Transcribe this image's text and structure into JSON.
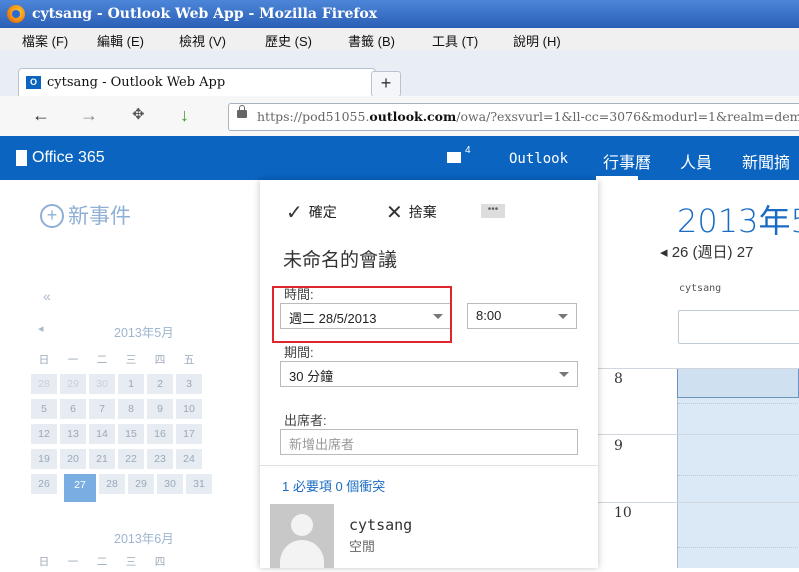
{
  "browser": {
    "window_title": "cytsang - Outlook Web App - Mozilla Firefox",
    "menu": [
      "檔案 (F)",
      "編輯 (E)",
      "檢視 (V)",
      "歷史 (S)",
      "書籤 (B)",
      "工具 (T)",
      "說明 (H)"
    ],
    "tab_title": "cytsang - Outlook Web App",
    "favicon_text": "O",
    "new_tab": "+",
    "url_prefix": "https://pod51055.",
    "url_host": "outlook.com",
    "url_suffix": "/owa/?exsvurl=1&ll-cc=3076&modurl=1&realm=dem"
  },
  "o365": {
    "brand": "Office 365",
    "mail_count": "4",
    "nav": [
      "Outlook",
      "行事曆",
      "人員",
      "新聞摘"
    ]
  },
  "left": {
    "new_event": "新事件",
    "prev": "«",
    "month1": "2013年5月",
    "month2": "2013年6月",
    "weekdays": [
      "日",
      "一",
      "二",
      "三",
      "四",
      "五"
    ],
    "rows": [
      [
        "28",
        "29",
        "30",
        "1",
        "2",
        "3"
      ],
      [
        "5",
        "6",
        "7",
        "8",
        "9",
        "10"
      ],
      [
        "12",
        "13",
        "14",
        "15",
        "16",
        "17"
      ],
      [
        "19",
        "20",
        "21",
        "22",
        "23",
        "24"
      ],
      [
        "26",
        "27",
        "28",
        "29",
        "30",
        "31"
      ]
    ],
    "weekdays2": [
      "日",
      "一",
      "二",
      "三",
      "四"
    ]
  },
  "form": {
    "ok": "確定",
    "discard": "捨棄",
    "more": "•••",
    "subject": "未命名的會議",
    "time_label": "時間:",
    "date_value": "週二 28/5/2013",
    "time_value": "8:00",
    "duration_label": "期間:",
    "duration_value": "30 分鐘",
    "attendees_label": "出席者:",
    "attendees_placeholder": "新增出席者",
    "summary": "1 必要項 0 個衝突",
    "attendee_name": "cytsang",
    "attendee_status": "空閒"
  },
  "calendar": {
    "title": "2013年5",
    "date_line": "◂ 26 (週日) 27",
    "column_owner": "cytsang",
    "hours": [
      "8",
      "9",
      "10"
    ]
  }
}
